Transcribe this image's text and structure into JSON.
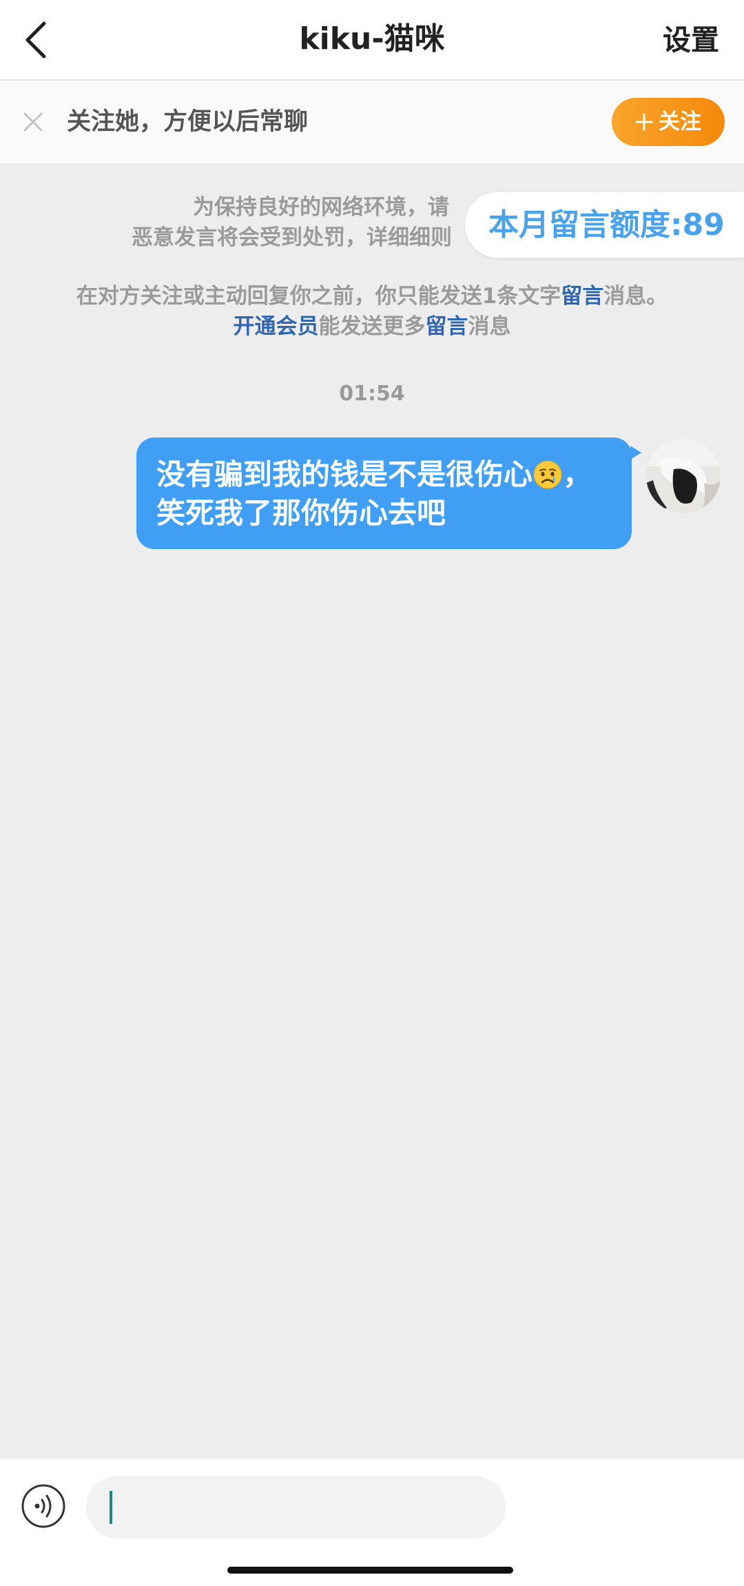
{
  "header": {
    "back_icon": "chevron-left-icon",
    "title": "kiku-猫咪",
    "settings_label": "设置"
  },
  "follow_banner": {
    "close_icon": "close-icon",
    "text": "关注她，方便以后常聊",
    "plus_icon": "plus-icon",
    "button_label": "关注"
  },
  "notices": {
    "line1": "为保持良好的网络环境，请",
    "line2": "恶意发言将会受到处罚，详细细则",
    "line3": {
      "a": "在对方关注或主动回复你之前，你只能发送1条文字",
      "link": "留言",
      "b": "消息。"
    },
    "line4": {
      "link1": "开通会员",
      "a": "能发送更多",
      "link2": "留言",
      "b": "消息"
    }
  },
  "quota_popup": {
    "text": "本月留言额度:89"
  },
  "messages": [
    {
      "time": "01:54",
      "from": "self",
      "line1_before": "没有骗到我的钱是不是很伤心",
      "emoji": "crying-face-icon",
      "line1_after": "，",
      "line2": "笑死我了那你伤心去吧"
    }
  ],
  "input": {
    "value": "",
    "voice_icon": "voice-icon"
  },
  "colors": {
    "bubble_blue": "#409ff5",
    "link_blue": "#2f66ad",
    "follow_orange_start": "#f9a52c",
    "follow_orange_end": "#f5890b",
    "popup_text_blue": "#4aa2ea"
  }
}
